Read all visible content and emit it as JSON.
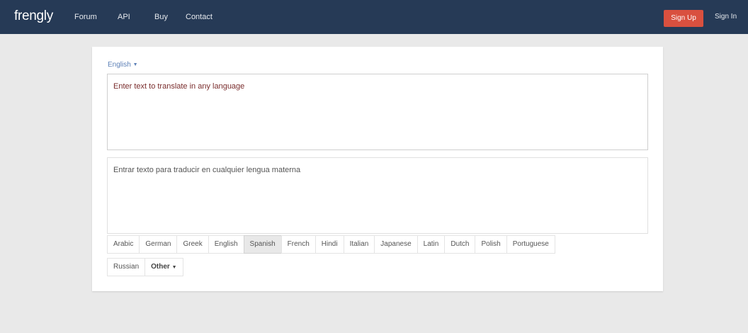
{
  "header": {
    "brand": "frengly",
    "nav": [
      "Forum",
      "API",
      "Buy",
      "Contact"
    ],
    "signup_label": "Sign Up",
    "signin_label": "Sign In"
  },
  "translator": {
    "source_language": "English",
    "source_text": "Enter text to translate in any language",
    "target_text": "Entrar texto para traducir en cualquier lengua materna",
    "languages_row1": [
      "Arabic",
      "German",
      "Greek",
      "English",
      "Spanish",
      "French",
      "Hindi",
      "Italian",
      "Japanese",
      "Latin",
      "Dutch",
      "Polish",
      "Portuguese"
    ],
    "languages_row2": [
      "Russian"
    ],
    "other_label": "Other",
    "selected_language": "Spanish"
  },
  "icons": {
    "dropdown_caret": "chevron-down-icon"
  },
  "colors": {
    "navbar": "#263a56",
    "signup": "#d9503f",
    "link": "#5b7fb6",
    "background": "#e9e9e9"
  }
}
